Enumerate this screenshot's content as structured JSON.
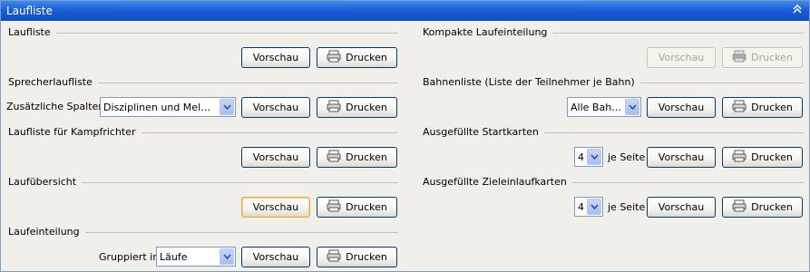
{
  "window": {
    "title": "Laufliste"
  },
  "left": {
    "laufliste": {
      "heading": "Laufliste",
      "preview": "Vorschau",
      "print": "Drucken"
    },
    "sprecher": {
      "heading": "Sprecherlaufliste",
      "label": "Zusätzliche Spalten:",
      "select_value": "Disziplinen und Meldeze…",
      "preview": "Vorschau",
      "print": "Drucken"
    },
    "kampfrichter": {
      "heading": "Laufliste für Kampfrichter",
      "preview": "Vorschau",
      "print": "Drucken"
    },
    "uebersicht": {
      "heading": "Laufübersicht",
      "preview": "Vorschau",
      "print": "Drucken"
    },
    "einteilung": {
      "heading": "Laufeinteilung",
      "label": "Gruppiert in",
      "select_value": "Läufe",
      "preview": "Vorschau",
      "print": "Drucken"
    }
  },
  "right": {
    "kompakt": {
      "heading": "Kompakte Laufeinteilung",
      "preview": "Vorschau",
      "print": "Drucken"
    },
    "bahnen": {
      "heading": "Bahnenliste (Liste der Teilnehmer je Bahn)",
      "select_value": "Alle Bahnen",
      "preview": "Vorschau",
      "print": "Drucken"
    },
    "startkarten": {
      "heading": "Ausgefüllte Startkarten",
      "select_value": "4",
      "per_page": "je Seite",
      "preview": "Vorschau",
      "print": "Drucken"
    },
    "zielkarten": {
      "heading": "Ausgefüllte Zieleinlaufkarten",
      "select_value": "4",
      "per_page": "je Seite",
      "preview": "Vorschau",
      "print": "Drucken"
    }
  }
}
